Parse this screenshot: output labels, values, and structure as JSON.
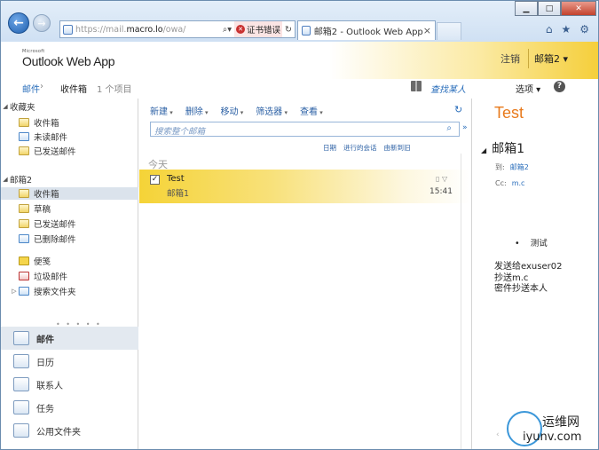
{
  "browser": {
    "url_prefix": "https://mail.",
    "url_host": "macro.lo",
    "url_path": "/owa/",
    "cert_error": "证书错误",
    "tab_title": "邮箱2 - Outlook Web App",
    "tab_close": "×",
    "minimize": "▁",
    "maximize": "□",
    "close": "✕",
    "back_glyph": "←",
    "fwd_glyph": "→",
    "home_icon": "⌂",
    "star_icon": "★",
    "gear_icon": "⚙"
  },
  "owa": {
    "logo_small": "Microsoft",
    "logo_name": "Outlook Web App",
    "signout": "注销",
    "user": "邮箱2 ▾"
  },
  "breadcrumb": {
    "root": "邮件",
    "arrow": "›",
    "folder": "收件箱",
    "count": "1 个项目",
    "find_people": "查找某人",
    "options": "选项 ▾",
    "help": "?"
  },
  "folders": {
    "favorites_header": "收藏夹",
    "favorites": [
      "收件箱",
      "未读邮件",
      "已发送邮件"
    ],
    "mailbox_header": "邮箱2",
    "mailbox": [
      "收件箱",
      "草稿",
      "已发送邮件",
      "已删除邮件"
    ],
    "extra": [
      "便笺",
      "垃圾邮件",
      "搜索文件夹"
    ],
    "dots": "• • • • •"
  },
  "nav": [
    "邮件",
    "日历",
    "联系人",
    "任务",
    "公用文件夹"
  ],
  "toolbar": [
    "新建",
    "删除",
    "移动",
    "筛选器",
    "查看"
  ],
  "search": {
    "placeholder": "搜索整个邮箱",
    "icon": "⌕",
    "expand": "»"
  },
  "sort": [
    "日期",
    "进行的会话",
    "由新到旧"
  ],
  "list": {
    "group": "今天",
    "messages": [
      {
        "subject": "Test",
        "from": "邮箱1",
        "time": "15:41"
      }
    ]
  },
  "reading": {
    "subject": "Test",
    "from": "邮箱1",
    "to_label": "到:",
    "to": "邮箱2",
    "cc_label": "Cc:",
    "cc": "m.c",
    "bullet": "测试",
    "lines": [
      "发送给exuser02",
      "抄送m.c",
      "密件抄送本人"
    ]
  },
  "watermark": {
    "line1": "运维网",
    "line2": "iyunv.com"
  }
}
